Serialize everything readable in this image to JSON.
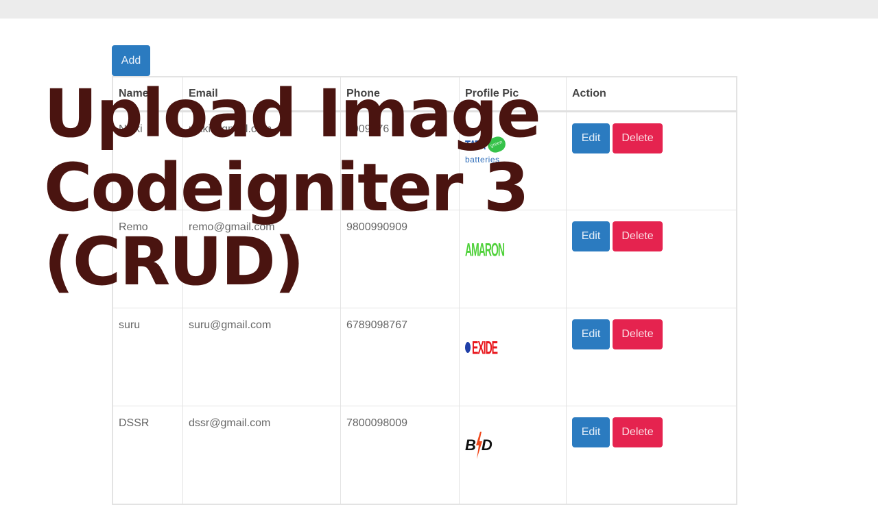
{
  "toolbar": {
    "add_label": "Add"
  },
  "table": {
    "headers": [
      "Name",
      "Email",
      "Phone",
      "Profile Pic",
      "Action"
    ],
    "rows": [
      {
        "name": "Nikki",
        "email": "nikki@gmail.com",
        "phone": "8009876",
        "pic": "tata-green-batteries-logo",
        "pic_text_1": "TATA",
        "pic_text_2": "green",
        "pic_text_3": "batteries"
      },
      {
        "name": "Remo",
        "email": "remo@gmail.com",
        "phone": "9800990909",
        "pic": "amaron-logo",
        "pic_text_1": "AMARON"
      },
      {
        "name": "suru",
        "email": "suru@gmail.com",
        "phone": "6789098767",
        "pic": "exide-logo",
        "pic_text_1": "EXIDE"
      },
      {
        "name": "DSSR",
        "email": "dssr@gmail.com",
        "phone": "7800098009",
        "pic": "bd-logo",
        "pic_text_1": "B",
        "pic_text_2": "D"
      }
    ],
    "edit_label": "Edit",
    "delete_label": "Delete"
  },
  "overlay_title": {
    "line1": "Upload Image",
    "line2": "Codeigniter 3",
    "line3": "(CRUD)"
  },
  "colors": {
    "primary": "#2b7bc0",
    "danger": "#e5234f",
    "title": "#4a1410"
  }
}
